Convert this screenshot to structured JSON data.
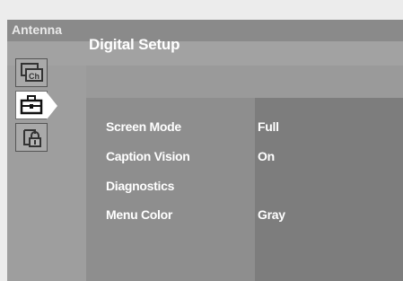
{
  "title_bar": {
    "label": "Antenna"
  },
  "page": {
    "heading": "Digital Setup"
  },
  "side_icons": [
    {
      "name": "channel-icon",
      "text": "Ch",
      "active": false
    },
    {
      "name": "toolbox-icon",
      "text": "",
      "active": true
    },
    {
      "name": "lock-icon",
      "text": "",
      "active": false
    }
  ],
  "menu": {
    "items": [
      {
        "label": "Screen Mode",
        "value": "Full"
      },
      {
        "label": "Caption Vision",
        "value": "On"
      },
      {
        "label": "Diagnostics",
        "value": ""
      },
      {
        "label": "Menu Color",
        "value": "Gray"
      }
    ]
  }
}
